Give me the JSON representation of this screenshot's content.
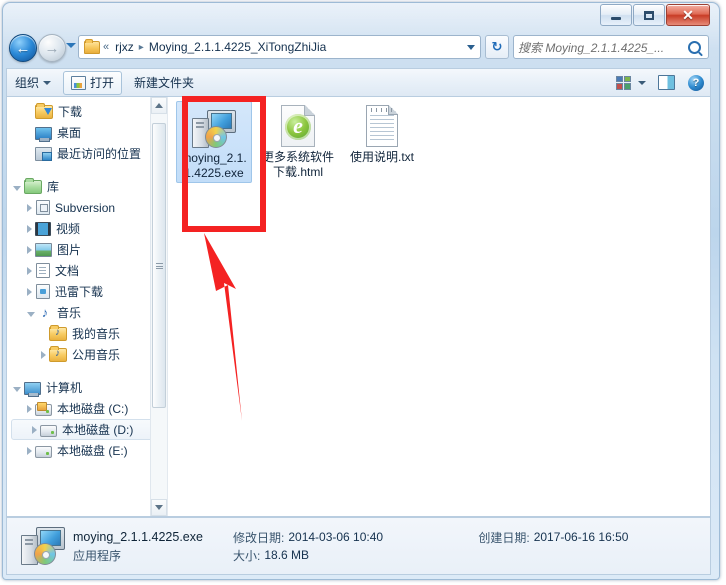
{
  "window": {
    "controls": {
      "minimize": "—",
      "maximize": "❐",
      "close": "✕"
    }
  },
  "nav": {
    "back_icon": "←",
    "forward_icon": "→",
    "history_dropdown": "▾",
    "breadcrumb": {
      "chevrons": "«",
      "items": [
        "rjxz",
        "Moying_2.1.1.4225_XiTongZhiJia"
      ],
      "separator": "▸"
    },
    "refresh_icon": "↻",
    "search": {
      "placeholder": "搜索 Moying_2.1.1.4225_...",
      "icon": "search-icon"
    }
  },
  "toolbar": {
    "organize_label": "组织",
    "open_label": "打开",
    "new_folder_label": "新建文件夹",
    "view_icon": "view-options-icon",
    "pane_icon": "preview-pane-icon",
    "help_icon": "?"
  },
  "sidebar": {
    "items": [
      {
        "label": "下载",
        "icon": "folder-download-icon",
        "indent": 1,
        "expander": "none",
        "selected": false
      },
      {
        "label": "桌面",
        "icon": "desktop-icon",
        "indent": 1,
        "expander": "none",
        "selected": false
      },
      {
        "label": "最近访问的位置",
        "icon": "recent-places-icon",
        "indent": 1,
        "expander": "none",
        "selected": false
      },
      {
        "label": "库",
        "icon": "library-folder-icon",
        "indent": 0,
        "expander": "open",
        "selected": false
      },
      {
        "label": "Subversion",
        "icon": "subversion-icon",
        "indent": 1,
        "expander": "closed",
        "selected": false
      },
      {
        "label": "视频",
        "icon": "video-library-icon",
        "indent": 1,
        "expander": "closed",
        "selected": false
      },
      {
        "label": "图片",
        "icon": "pictures-library-icon",
        "indent": 1,
        "expander": "closed",
        "selected": false
      },
      {
        "label": "文档",
        "icon": "documents-library-icon",
        "indent": 1,
        "expander": "closed",
        "selected": false
      },
      {
        "label": "迅雷下载",
        "icon": "xunlei-download-icon",
        "indent": 1,
        "expander": "closed",
        "selected": false
      },
      {
        "label": "音乐",
        "icon": "music-library-icon",
        "indent": 1,
        "expander": "open",
        "selected": false
      },
      {
        "label": "我的音乐",
        "icon": "folder-music-icon",
        "indent": 2,
        "expander": "none",
        "selected": false
      },
      {
        "label": "公用音乐",
        "icon": "folder-music-icon",
        "indent": 2,
        "expander": "closed",
        "selected": false
      },
      {
        "label": "计算机",
        "icon": "computer-icon",
        "indent": 0,
        "expander": "open",
        "selected": false
      },
      {
        "label": "本地磁盘 (C:)",
        "icon": "system-drive-icon",
        "indent": 1,
        "expander": "closed",
        "selected": false
      },
      {
        "label": "本地磁盘 (D:)",
        "icon": "drive-icon",
        "indent": 1,
        "expander": "closed",
        "selected": true
      },
      {
        "label": "本地磁盘 (E:)",
        "icon": "drive-icon",
        "indent": 1,
        "expander": "closed",
        "selected": false
      }
    ],
    "scrollbar": {
      "up": "▲",
      "down": "▼"
    }
  },
  "files": [
    {
      "name": "moying_2.1.1.4225.exe",
      "icon": "application-exe-icon",
      "selected": true
    },
    {
      "name": "更多系统软件下载.html",
      "icon": "html-document-icon",
      "selected": false
    },
    {
      "name": "使用说明.txt",
      "icon": "text-document-icon",
      "selected": false
    }
  ],
  "status": {
    "file_name": "moying_2.1.1.4225.exe",
    "file_type": "应用程序",
    "modified_label": "修改日期:",
    "modified_value": "2014-03-06 10:40",
    "size_label": "大小:",
    "size_value": "18.6 MB",
    "created_label": "创建日期:",
    "created_value": "2017-06-16 16:50",
    "icon": "application-exe-icon"
  },
  "annotations": {
    "highlight_color": "#f42222",
    "rect_target": "moying_2.1.1.4225.exe",
    "arrow_direction": "up-left"
  }
}
